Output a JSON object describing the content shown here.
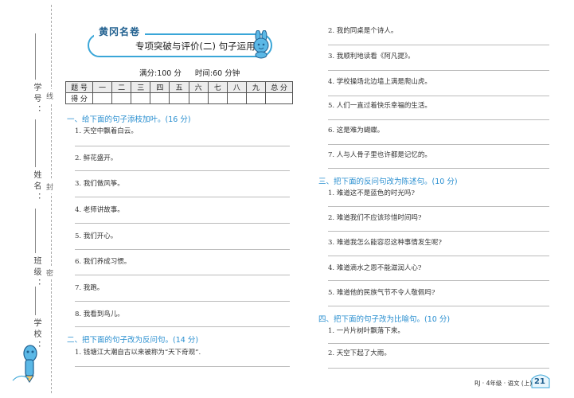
{
  "binding": {
    "fields": [
      {
        "label": "学号："
      },
      {
        "label": "姓名："
      },
      {
        "label": "班级："
      },
      {
        "label": "学校："
      }
    ],
    "cut_words": [
      "线",
      "封",
      "密"
    ]
  },
  "header": {
    "brand": "黄冈名卷",
    "title": "专项突破与评价(二)   句子运用",
    "full_score": "满分:100 分",
    "time": "时间:60 分钟"
  },
  "score_table": {
    "row1": [
      "题  号",
      "一",
      "二",
      "三",
      "四",
      "五",
      "六",
      "七",
      "八",
      "九",
      "总  分"
    ],
    "row2": [
      "得  分",
      "",
      "",
      "",
      "",
      "",
      "",
      "",
      "",
      "",
      ""
    ]
  },
  "left": {
    "section1": "一、给下面的句子添枝加叶。(16 分)",
    "items1": [
      "1. 天空中飘着白云。",
      "2. 鲜花盛开。",
      "3. 我们做风筝。",
      "4. 老师讲故事。",
      "5. 我们开心。",
      "6. 我们养成习惯。",
      "7. 我跑。",
      "8. 我看到鸟儿。"
    ],
    "section2": "二、把下面的句子改为反问句。(14 分)",
    "items2": [
      "1. 钱塘江大潮自古以来被称为“天下奇观”."
    ]
  },
  "right": {
    "items2": [
      "2. 我的同桌是个诗人。",
      "3. 我顺利地读看《阿凡提》。",
      "4. 学校操场北边墙上满是爬山虎。",
      "5. 人们一直过着快乐幸福的生活。",
      "6. 这是难为蝴蝶。",
      "7. 人与人骨子里也许都是记忆的。"
    ],
    "section3": "三、把下面的反问句改为陈述句。(10 分)",
    "items3": [
      "1. 难道这不是蓝色的时光吗?",
      "2. 难道我们不应该珍惜时间吗?",
      "3. 难道我怎么能容忍这种事情发生呢?",
      "4. 难道滴水之恩不能滋润人心?",
      "5. 难道他的民族气节不令人敬佩吗?"
    ],
    "section4": "四、把下面的句子改为比喻句。(10 分)",
    "items4": [
      "1. 一片片树叶飘落下来。",
      "2. 天空下起了大雨。"
    ]
  },
  "footer": {
    "text": "RJ · 4年级 · 语文 (上)",
    "page": "21"
  },
  "colors": {
    "accent": "#2a8fd0",
    "border": "#3aa6d8",
    "brand": "#1f5f8f"
  }
}
